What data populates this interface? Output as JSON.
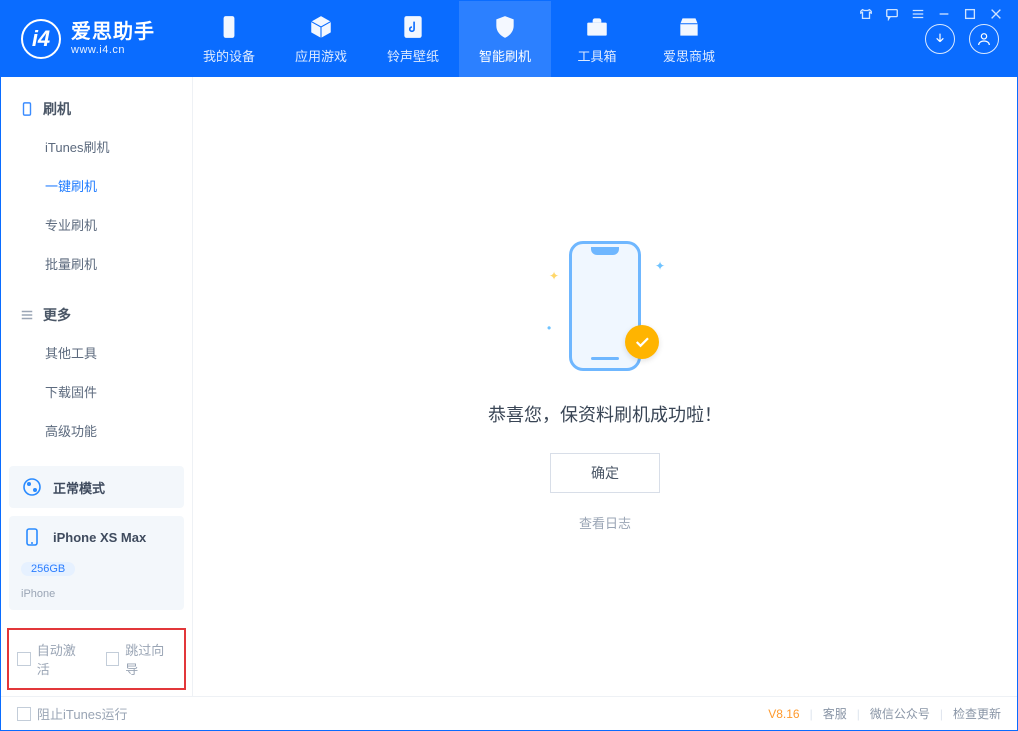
{
  "app": {
    "title": "爱思助手",
    "subtitle": "www.i4.cn"
  },
  "nav": {
    "tabs": [
      {
        "label": "我的设备",
        "icon": "device"
      },
      {
        "label": "应用游戏",
        "icon": "cube"
      },
      {
        "label": "铃声壁纸",
        "icon": "music"
      },
      {
        "label": "智能刷机",
        "icon": "shield",
        "active": true
      },
      {
        "label": "工具箱",
        "icon": "toolbox"
      },
      {
        "label": "爱思商城",
        "icon": "store"
      }
    ]
  },
  "sidebar": {
    "section1": {
      "title": "刷机",
      "items": [
        {
          "label": "iTunes刷机"
        },
        {
          "label": "一键刷机",
          "active": true
        },
        {
          "label": "专业刷机"
        },
        {
          "label": "批量刷机"
        }
      ]
    },
    "section2": {
      "title": "更多",
      "items": [
        {
          "label": "其他工具"
        },
        {
          "label": "下载固件"
        },
        {
          "label": "高级功能"
        }
      ]
    },
    "mode": {
      "label": "正常模式"
    },
    "device": {
      "name": "iPhone XS Max",
      "storage": "256GB",
      "type": "iPhone"
    },
    "checks": {
      "auto_activate": "自动激活",
      "skip_guide": "跳过向导"
    }
  },
  "main": {
    "message": "恭喜您，保资料刷机成功啦！",
    "ok": "确定",
    "log": "查看日志"
  },
  "footer": {
    "block_itunes": "阻止iTunes运行",
    "version": "V8.16",
    "links": [
      "客服",
      "微信公众号",
      "检查更新"
    ]
  }
}
